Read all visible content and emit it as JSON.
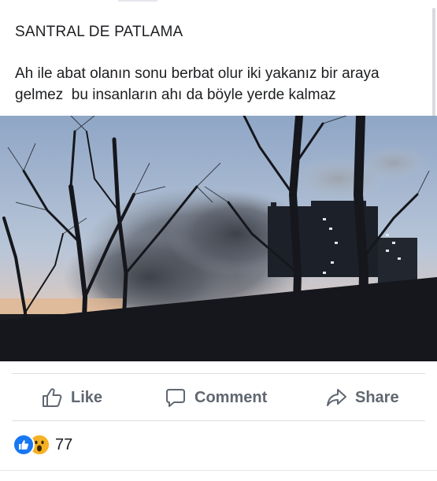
{
  "post": {
    "title": "SANTRAL DE PATLAMA",
    "text": "Ah ile abat olanın sonu berbat olur iki yakanız bir araya\ngelmez  bu insanların ahı da böyle yerde kalmaz"
  },
  "actions": {
    "like_label": "Like",
    "comment_label": "Comment",
    "share_label": "Share"
  },
  "reactions": {
    "count": "77",
    "types": [
      "like-icon",
      "wow-icon"
    ]
  },
  "colors": {
    "action_text": "#606770",
    "like_blue": "#1877f2",
    "wow_yellow": "#f7b125",
    "divider": "#dadde1"
  }
}
